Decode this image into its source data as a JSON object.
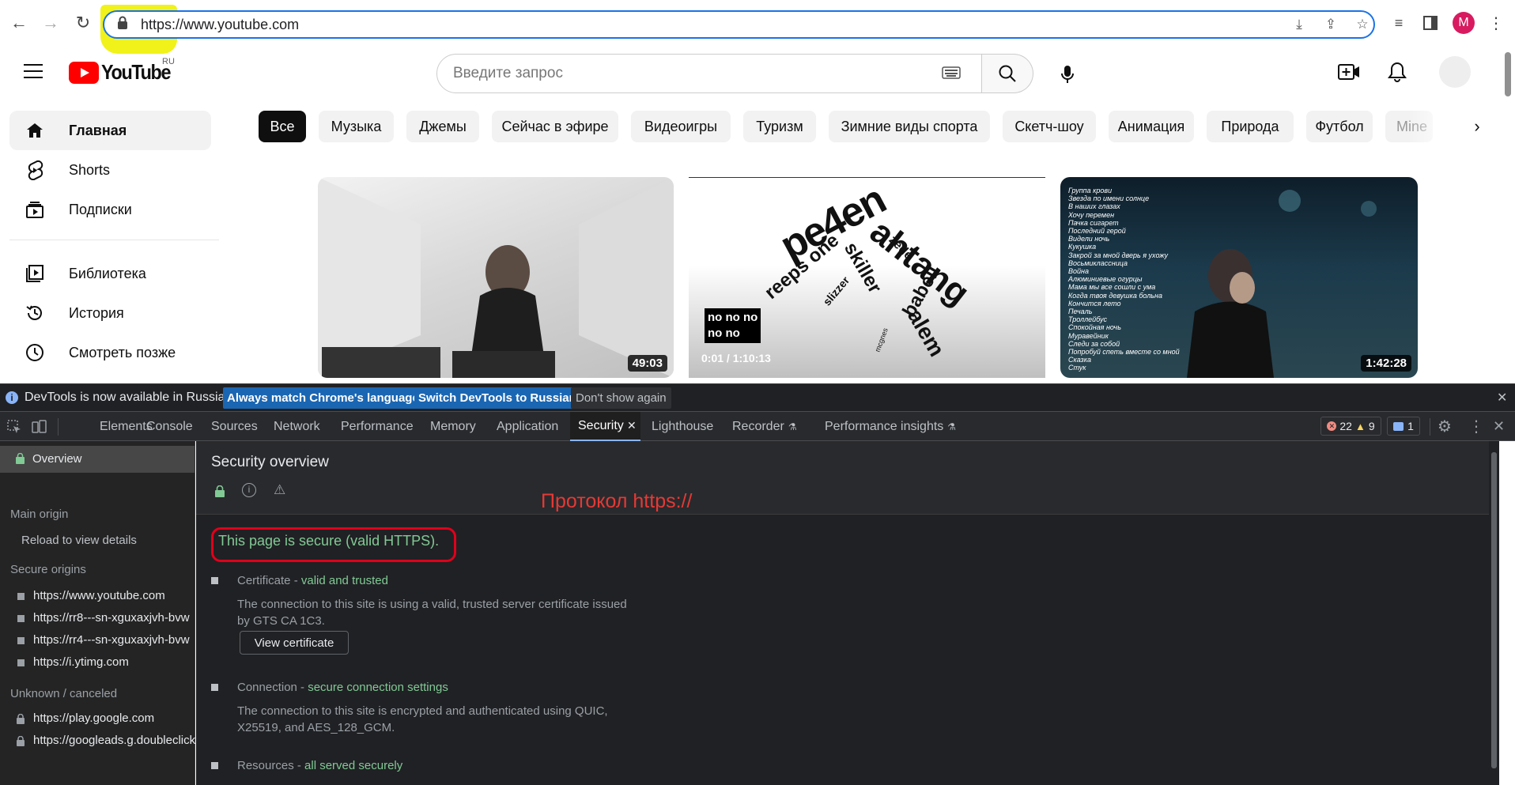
{
  "browser": {
    "url": "https://www.youtube.com",
    "avatar_letter": "M"
  },
  "youtube": {
    "logo_text": "YouTube",
    "region": "RU",
    "search_placeholder": "Введите запрос",
    "sidebar": [
      {
        "label": "Главная",
        "icon": "home-icon"
      },
      {
        "label": "Shorts",
        "icon": "shorts-icon"
      },
      {
        "label": "Подписки",
        "icon": "subscriptions-icon"
      },
      {
        "label": "Библиотека",
        "icon": "library-icon"
      },
      {
        "label": "История",
        "icon": "history-icon"
      },
      {
        "label": "Смотреть позже",
        "icon": "watch-later-icon"
      }
    ],
    "chips": [
      "Все",
      "Музыка",
      "Джемы",
      "Сейчас в эфире",
      "Видеоигры",
      "Туризм",
      "Зимние виды спорта",
      "Скетч-шоу",
      "Анимация",
      "Природа",
      "Футбол",
      "Mine"
    ],
    "videos": [
      {
        "duration": "49:03"
      },
      {
        "overlay_lines": [
          "no no no",
          "no no"
        ],
        "progress": "0:01 / 1:10:13",
        "words": [
          "pe4en",
          "ahtang",
          "zede",
          "reeps one",
          "skiller",
          "slizzer",
          "babeli",
          "alem",
          "mcgnes"
        ]
      },
      {
        "duration": "1:42:28",
        "lyrics": [
          "Группа крови",
          "Звезда по имени солнце",
          "В наших глазах",
          "Хочу перемен",
          "Пачка сигарет",
          "Последний герой",
          "Видели ночь",
          "Кукушка",
          "Закрой за мной дверь я ухожу",
          "Восьмиклассница",
          "Война",
          "Алюминиевые огурцы",
          "Мама мы все сошли с ума",
          "Когда твоя девушка больна",
          "Кончится лето",
          "Печаль",
          "Троллейбус",
          "Спокойная ночь",
          "Муравейник",
          "Следи за собой",
          "Попробуй спеть вместе со мной",
          "Сказка",
          "Стук"
        ]
      }
    ]
  },
  "devtools": {
    "infobar": {
      "message": "DevTools is now available in Russian!",
      "btn_match": "Always match Chrome's language",
      "btn_switch": "Switch DevTools to Russian",
      "btn_dont": "Don't show again"
    },
    "tabs": [
      "Elements",
      "Console",
      "Sources",
      "Network",
      "Performance",
      "Memory",
      "Application",
      "Security",
      "Lighthouse",
      "Recorder",
      "Performance insights"
    ],
    "errors": "22",
    "warnings": "9",
    "messages": "1",
    "sidebar": {
      "overview": "Overview",
      "main_origin": "Main origin",
      "reload": "Reload to view details",
      "secure_origins": "Secure origins",
      "secure_list": [
        "https://www.youtube.com",
        "https://rr8---sn-xguxaxjvh-bvw",
        "https://rr4---sn-xguxaxjvh-bvw",
        "https://i.ytimg.com"
      ],
      "unknown": "Unknown / canceled",
      "unknown_list": [
        "https://play.google.com",
        "https://googleads.g.doubleclick"
      ]
    },
    "security": {
      "title": "Security overview",
      "annotation": "Протокол https://",
      "summary": "This page is secure (valid HTTPS).",
      "cert_label": "Certificate - ",
      "cert_status": "valid and trusted",
      "cert_desc": "The connection to this site is using a valid, trusted server certificate issued by GTS CA 1C3.",
      "view_cert": "View certificate",
      "conn_label": "Connection - ",
      "conn_status": "secure connection settings",
      "conn_desc": "The connection to this site is encrypted and authenticated using QUIC, X25519, and AES_128_GCM.",
      "res_label": "Resources - ",
      "res_status": "all served securely"
    }
  }
}
